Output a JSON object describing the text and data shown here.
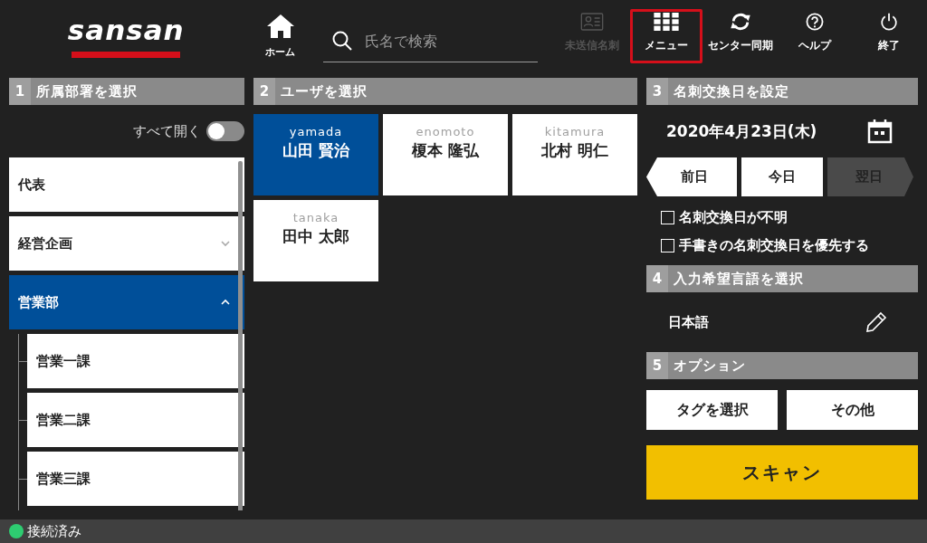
{
  "logo": "sansan",
  "home": {
    "label": "ホーム"
  },
  "search": {
    "placeholder": "氏名で検索"
  },
  "nav": [
    {
      "kind": "card",
      "label": "未送信名刺",
      "disabled": true,
      "selected": false
    },
    {
      "kind": "grid",
      "label": "メニュー",
      "disabled": false,
      "selected": true
    },
    {
      "kind": "sync",
      "label": "センター同期",
      "disabled": false,
      "selected": false
    },
    {
      "kind": "help",
      "label": "ヘルプ",
      "disabled": false,
      "selected": false
    },
    {
      "kind": "power",
      "label": "終了",
      "disabled": false,
      "selected": false
    }
  ],
  "departments": {
    "number": "1",
    "title": "所属部署を選択",
    "expand_all": {
      "label": "すべて開く",
      "on": false
    },
    "items": [
      {
        "label": "代表",
        "selected": false
      },
      {
        "label": "経営企画",
        "selected": false,
        "expanded": false
      },
      {
        "label": "営業部",
        "selected": true,
        "expanded": true,
        "children": [
          {
            "label": "営業一課",
            "selected": false
          },
          {
            "label": "営業二課",
            "selected": false
          },
          {
            "label": "営業三課",
            "selected": false
          }
        ]
      }
    ]
  },
  "users": {
    "number": "2",
    "title": "ユーザを選択",
    "items": [
      {
        "id_label": "yamada",
        "name": "山田 賢治",
        "selected": true
      },
      {
        "id_label": "enomoto",
        "name": "榎本 隆弘",
        "selected": false
      },
      {
        "id_label": "kitamura",
        "name": "北村 明仁",
        "selected": false
      },
      {
        "id_label": "tanaka",
        "name": "田中 太郎",
        "selected": false
      }
    ]
  },
  "exchange_date": {
    "number": "3",
    "title": "名刺交換日を設定",
    "date": "2020年4月23日(木)",
    "buttons": [
      {
        "kind": "prev",
        "label": "前日",
        "disabled": false
      },
      {
        "kind": "today",
        "label": "今日",
        "disabled": false
      },
      {
        "kind": "next",
        "label": "翌日",
        "disabled": true
      }
    ],
    "checkboxes": [
      {
        "label": "名刺交換日が不明",
        "checked": false
      },
      {
        "label": "手書きの名刺交換日を優先する",
        "checked": false
      }
    ]
  },
  "language": {
    "number": "4",
    "title": "入力希望言語を選択",
    "value": "日本語"
  },
  "options": {
    "number": "5",
    "title": "オプション",
    "buttons": [
      "タグを選択",
      "その他"
    ]
  },
  "scan_button": "スキャン",
  "status_bar": {
    "label": "接続済み",
    "color": "#2ecc71"
  }
}
